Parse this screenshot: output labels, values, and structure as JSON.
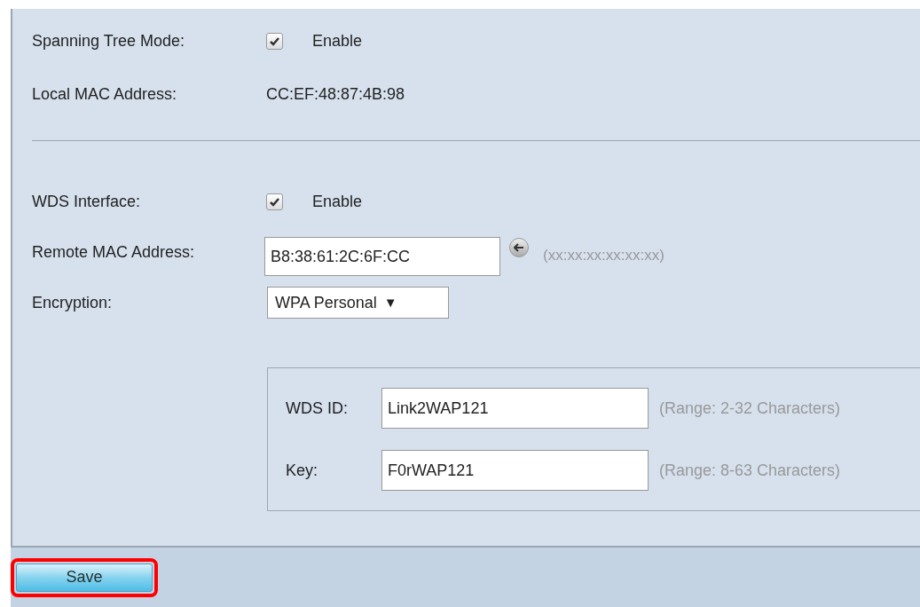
{
  "settings": [
    {
      "kind": "checkbox",
      "label": "Spanning Tree Mode:",
      "checked": true,
      "option": "Enable"
    },
    {
      "kind": "text",
      "label": "Local MAC Address:",
      "value": "CC:EF:48:87:4B:98"
    },
    {
      "kind": "divider"
    },
    {
      "kind": "checkbox",
      "label": "WDS Interface:",
      "checked": true,
      "option": "Enable"
    },
    {
      "kind": "input",
      "label": "Remote MAC Address:",
      "value": "B8:38:61:2C:6F:CC",
      "hint": "(xx:xx:xx:xx:xx:xx)"
    },
    {
      "kind": "select",
      "label": "Encryption:",
      "value": "WPA Personal",
      "arrow": "▼"
    }
  ],
  "wpa_fields": [
    {
      "label": "WDS ID:",
      "value": "Link2WAP121",
      "hint": "(Range: 2-32 Characters)"
    },
    {
      "label": "Key:",
      "value": "F0rWAP121",
      "hint": "(Range: 8-63 Characters)"
    }
  ],
  "save_button": {
    "label": "Save",
    "highlighted": true
  }
}
